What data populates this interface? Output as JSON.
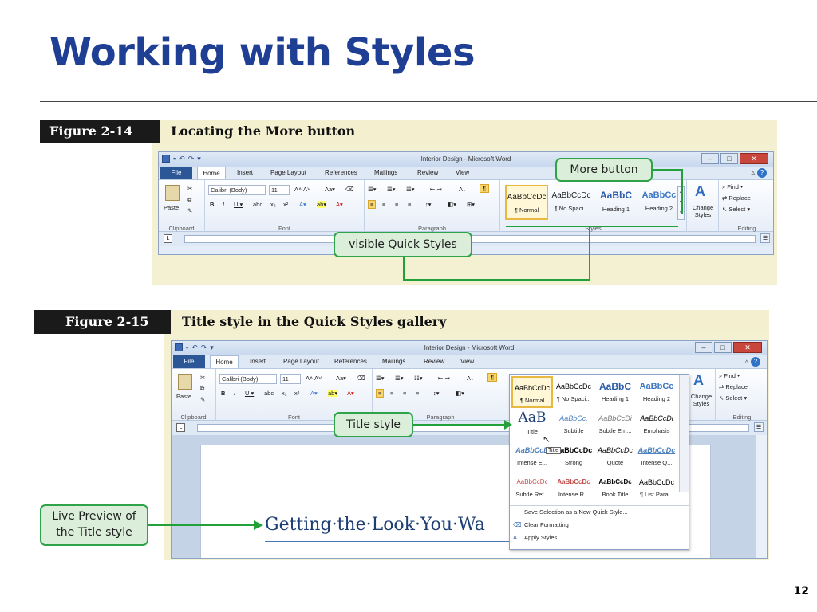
{
  "slide": {
    "title": "Working with Styles",
    "page_number": "12"
  },
  "fig1": {
    "label": "Figure 2-14",
    "caption": "Locating the More button",
    "callout_more": "More button",
    "callout_quick": "visible Quick Styles"
  },
  "fig2": {
    "label": "Figure 2-15",
    "caption": "Title style in the Quick Styles gallery",
    "callout_title": "Title style",
    "callout_live": "Live Preview of\nthe Title style",
    "live_preview_text": "Getting·the·Look·You·Wa",
    "tooltip": "Title"
  },
  "word": {
    "window_title": "Interior Design - Microsoft Word",
    "tabs": [
      "File",
      "Home",
      "Insert",
      "Page Layout",
      "References",
      "Mailings",
      "Review",
      "View"
    ],
    "font_name": "Calibri (Body)",
    "font_size": "11",
    "paste_label": "Paste",
    "change_styles_label": "Change Styles",
    "find_label": "Find",
    "replace_label": "Replace",
    "select_label": "Select",
    "groups": [
      "Clipboard",
      "Font",
      "Paragraph",
      "Styles",
      "Editing"
    ]
  },
  "ribbon_styles": [
    {
      "preview": "AaBbCcDc",
      "name": "¶ Normal"
    },
    {
      "preview": "AaBbCcDc",
      "name": "¶ No Spaci..."
    },
    {
      "preview": "AaBbC",
      "name": "Heading 1"
    },
    {
      "preview": "AaBbCc",
      "name": "Heading 2"
    }
  ],
  "gallery_styles": [
    {
      "preview": "AaBbCcDc",
      "name": "¶ Normal"
    },
    {
      "preview": "AaBbCcDc",
      "name": "¶ No Spaci..."
    },
    {
      "preview": "AaBbC",
      "name": "Heading 1"
    },
    {
      "preview": "AaBbCc",
      "name": "Heading 2"
    },
    {
      "preview": "AaB",
      "name": "Title"
    },
    {
      "preview": "AaBbCc.",
      "name": "Subtitle"
    },
    {
      "preview": "AaBbCcDi",
      "name": "Subtle Em..."
    },
    {
      "preview": "AaBbCcDi",
      "name": "Emphasis"
    },
    {
      "preview": "AaBbCcD",
      "name": "Intense E..."
    },
    {
      "preview": "AaBbCcDc",
      "name": "Strong"
    },
    {
      "preview": "AaBbCcDc",
      "name": "Quote"
    },
    {
      "preview": "AaBbCcDc",
      "name": "Intense Q..."
    },
    {
      "preview": "AaBbCcDc",
      "name": "Subtle Ref..."
    },
    {
      "preview": "AaBbCcDc",
      "name": "Intense R..."
    },
    {
      "preview": "AaBbCcDc",
      "name": "Book Title"
    },
    {
      "preview": "AaBbCcDc",
      "name": "¶ List Para..."
    }
  ],
  "gallery_commands": [
    "Save Selection as a New Quick Style...",
    "Clear Formatting",
    "Apply Styles..."
  ],
  "colors": {
    "title_blue": "#1f3f94",
    "callout_green": "#2fa349",
    "callout_fill": "#dbeed9",
    "selection_gold": "#e9b842"
  }
}
